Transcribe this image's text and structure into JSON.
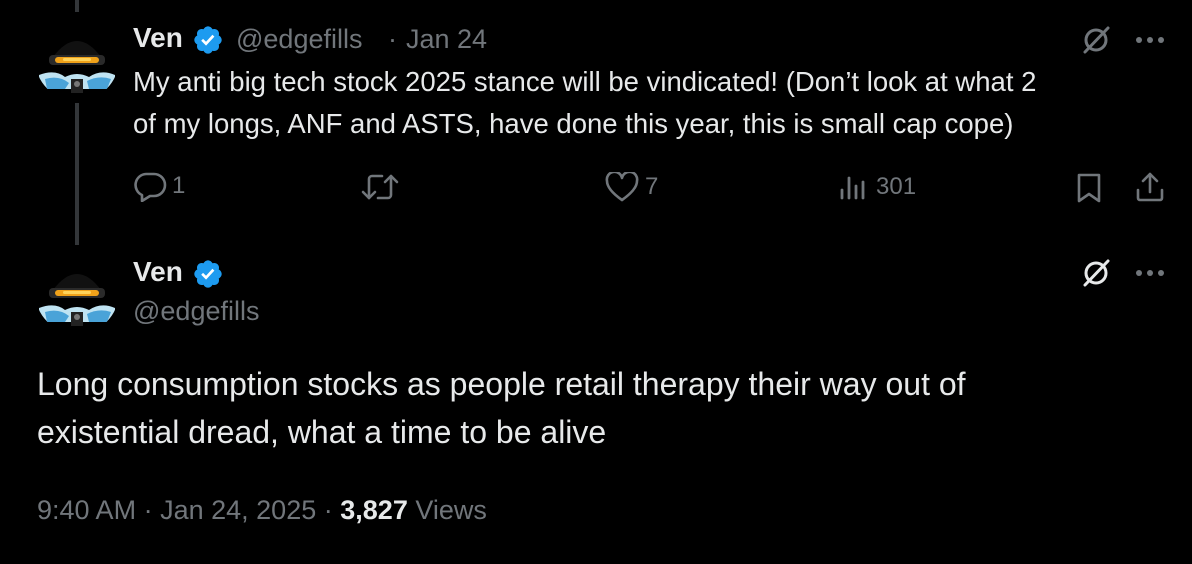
{
  "parent_tweet": {
    "display_name": "Ven",
    "handle": "@edgefills",
    "separator": "·",
    "date": "Jan 24",
    "text_line1": "My anti big tech stock 2025 stance will be vindicated! (Don’t look at what 2",
    "text_line2": "of my longs, ANF and ASTS, have done this year, this is small cap cope)",
    "reply_count": "1",
    "like_count": "7",
    "view_count": "301"
  },
  "main_tweet": {
    "display_name": "Ven",
    "handle": "@edgefills",
    "text_line1": "Long consumption stocks as people retail therapy their way out of",
    "text_line2": "existential dread, what a time to be alive",
    "time": "9:40 AM",
    "separator1": "·",
    "date": "Jan 24, 2025",
    "separator2": "·",
    "views_count": "3,827",
    "views_label": "Views"
  },
  "colors": {
    "background": "#000000",
    "text": "#e7e9ea",
    "muted": "#71767b",
    "verified": "#1d9bf0"
  },
  "icons": [
    "avatar",
    "verified-badge-icon",
    "grok-icon",
    "more-icon",
    "reply-icon",
    "retweet-icon",
    "like-icon",
    "views-icon",
    "bookmark-icon",
    "share-icon"
  ]
}
